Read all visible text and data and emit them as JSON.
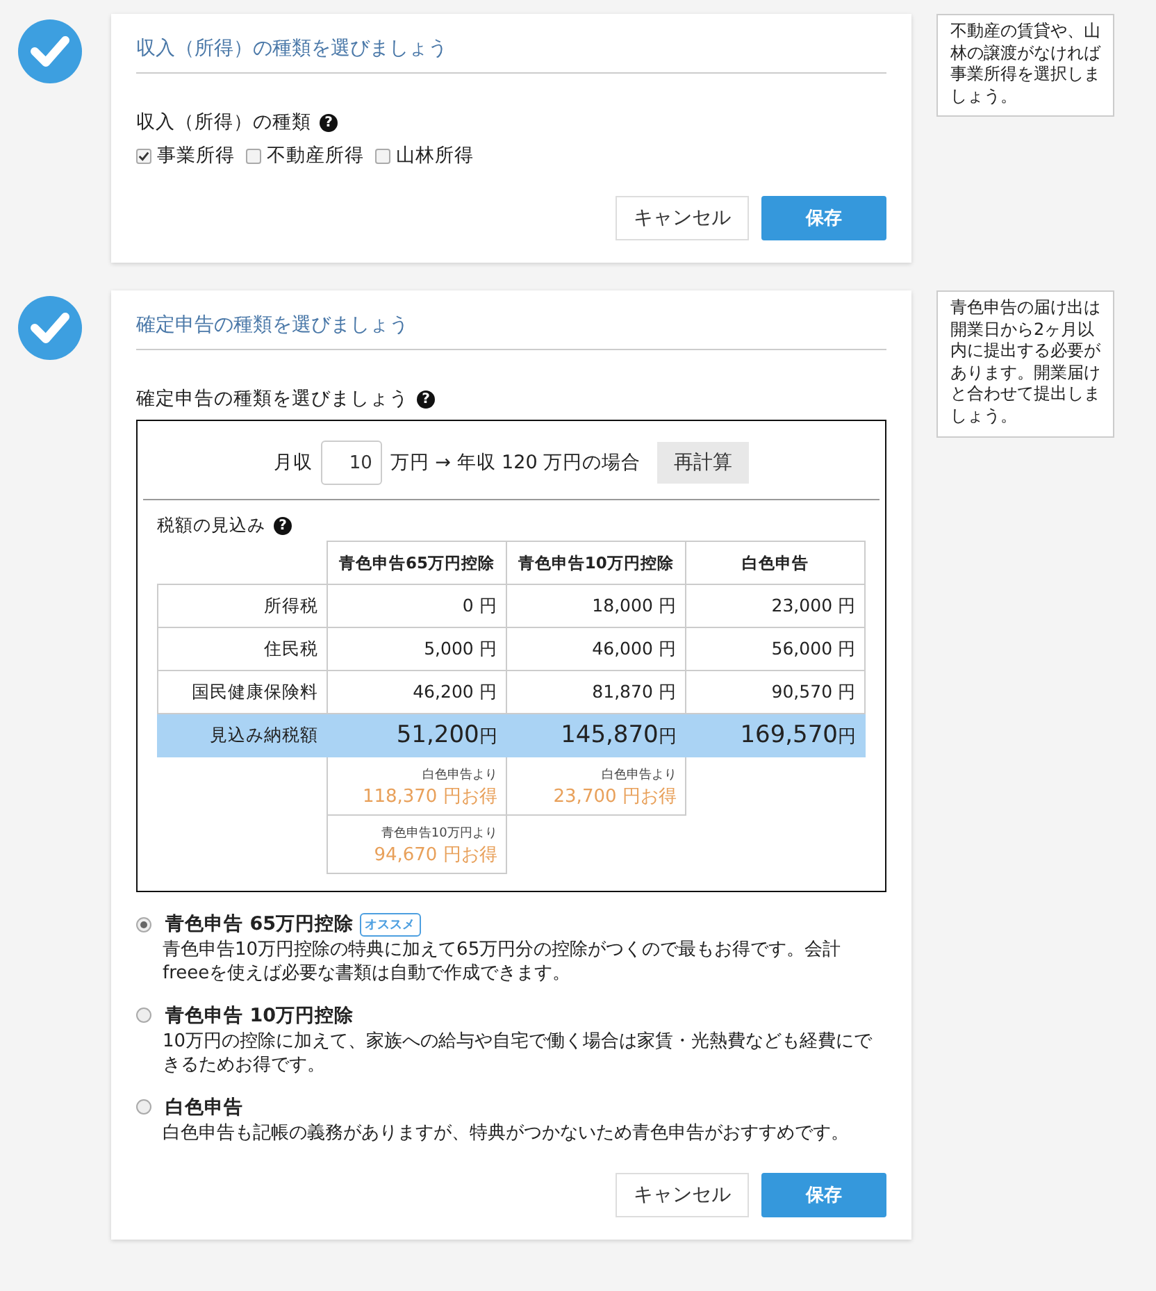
{
  "sections": [
    {
      "done": true,
      "title": "収入（所得）の種類を選びましょう",
      "field_label": "収入（所得）の種類",
      "help": "?",
      "checkboxes": [
        {
          "label": "事業所得",
          "checked": true
        },
        {
          "label": "不動産所得",
          "checked": false
        },
        {
          "label": "山林所得",
          "checked": false
        }
      ],
      "buttons": {
        "cancel": "キャンセル",
        "save": "保存"
      },
      "tip": "不動産の賃貸や、山林の譲渡がなければ事業所得を選択しましょう。"
    },
    {
      "done": true,
      "title": "確定申告の種類を選びましょう",
      "field_label": "確定申告の種類を選びましょう",
      "help": "?",
      "calculator": {
        "prefix": "月収",
        "value": "10",
        "suffix": "万円 → 年収 120 万円の場合",
        "button": "再計算"
      },
      "estimate": {
        "title": "税額の見込み",
        "columns": [
          "青色申告65万円控除",
          "青色申告10万円控除",
          "白色申告"
        ],
        "rows": [
          {
            "label": "所得税",
            "values": [
              "0 円",
              "18,000 円",
              "23,000 円"
            ]
          },
          {
            "label": "住民税",
            "values": [
              "5,000 円",
              "46,000 円",
              "56,000 円"
            ]
          },
          {
            "label": "国民健康保険料",
            "values": [
              "46,200 円",
              "81,870 円",
              "90,570 円"
            ]
          }
        ],
        "total": {
          "label": "見込み納税額",
          "values": [
            {
              "amount": "51,200",
              "unit": "円"
            },
            {
              "amount": "145,870",
              "unit": "円"
            },
            {
              "amount": "169,570",
              "unit": "円"
            }
          ]
        },
        "savings": [
          [
            {
              "caption": "白色申告より",
              "amount": "118,370 円お得"
            },
            {
              "caption": "白色申告より",
              "amount": "23,700 円お得"
            }
          ],
          [
            {
              "caption": "青色申告10万円より",
              "amount": "94,670 円お得"
            }
          ]
        ]
      },
      "options": [
        {
          "title": "青色申告 65万円控除",
          "badge": "オススメ",
          "description": "青色申告10万円控除の特典に加えて65万円分の控除がつくので最もお得です。会計freeeを使えば必要な書類は自動で作成できます。",
          "selected": true
        },
        {
          "title": "青色申告 10万円控除",
          "description": "10万円の控除に加えて、家族への給与や自宅で働く場合は家賃・光熱費なども経費にできるためお得です。",
          "selected": false
        },
        {
          "title": "白色申告",
          "description": "白色申告も記帳の義務がありますが、特典がつかないため青色申告がおすすめです。",
          "selected": false
        }
      ],
      "buttons": {
        "cancel": "キャンセル",
        "save": "保存"
      },
      "tip": "青色申告の届け出は開業日から2ヶ月以内に提出する必要があります。開業届けと合わせて提出しましょう。"
    }
  ]
}
